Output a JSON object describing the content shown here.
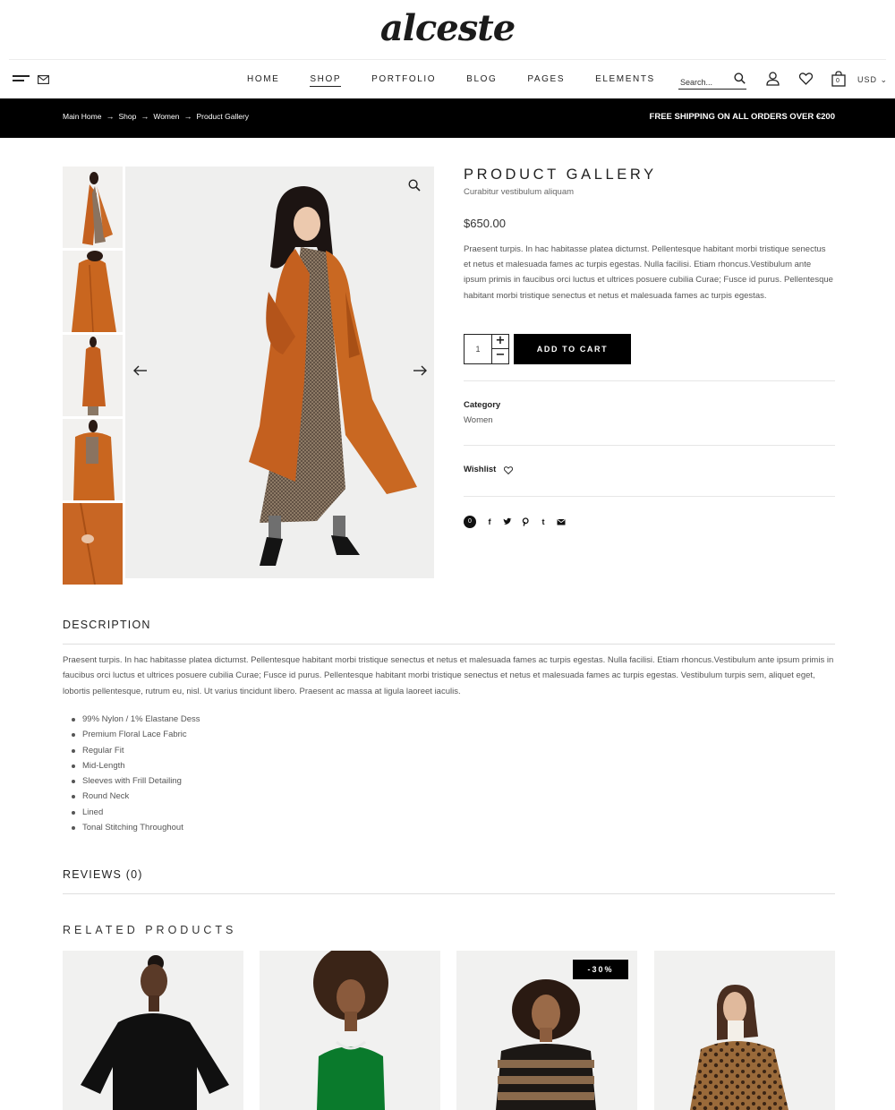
{
  "brand": {
    "logo": "alceste"
  },
  "nav": {
    "links": [
      "HOME",
      "SHOP",
      "PORTFOLIO",
      "BLOG",
      "PAGES",
      "ELEMENTS"
    ],
    "active": "SHOP",
    "search_placeholder": "Search...",
    "cart_count": "0",
    "currency": "USD"
  },
  "breadcrumb": [
    "Main Home",
    "Shop",
    "Women",
    "Product Gallery"
  ],
  "shipping_notice": "FREE SHIPPING ON ALL ORDERS OVER €200",
  "product": {
    "title": "PRODUCT GALLERY",
    "subtitle": "Curabitur vestibulum aliquam",
    "price": "$650.00",
    "description": "Praesent turpis. In hac habitasse platea dictumst. Pellentesque habitant morbi tristique senectus et netus et malesuada fames ac turpis egestas. Nulla facilisi. Etiam rhoncus.Vestibulum ante ipsum primis in faucibus orci luctus et ultrices posuere cubilia Curae; Fusce id purus. Pellentesque habitant morbi tristique senectus et netus et malesuada fames ac turpis egestas.",
    "quantity": "1",
    "add_to_cart": "ADD TO CART",
    "category_label": "Category",
    "category_value": "Women",
    "wishlist_label": "Wishlist",
    "share_count": "0",
    "share_icons": [
      "facebook-icon",
      "twitter-icon",
      "pinterest-icon",
      "tumblr-icon",
      "email-icon"
    ]
  },
  "description_section": {
    "title": "DESCRIPTION",
    "body": "Praesent turpis. In hac habitasse platea dictumst. Pellentesque habitant morbi tristique senectus et netus et malesuada fames ac turpis egestas. Nulla facilisi. Etiam rhoncus.Vestibulum ante ipsum primis in faucibus orci luctus et ultrices posuere cubilia Curae; Fusce id purus. Pellentesque habitant morbi tristique senectus et netus et malesuada fames ac turpis egestas. Vestibulum turpis sem, aliquet eget, lobortis pellentesque, rutrum eu, nisl. Ut varius tincidunt libero. Praesent ac massa at ligula laoreet iaculis.",
    "features": [
      "99% Nylon / 1% Elastane Dess",
      "Premium Floral Lace Fabric",
      "Regular Fit",
      "Mid-Length",
      "Sleeves with Frill Detailing",
      "Round Neck",
      "Lined",
      "Tonal Stitching Throughout"
    ]
  },
  "reviews_title": "REVIEWS (0)",
  "related": {
    "title": "RELATED PRODUCTS",
    "sale_badge": "-30%"
  },
  "colors": {
    "accent": "#000000",
    "coat": "#c4601f",
    "page_bg": "#ffffff",
    "image_bg": "#efefee"
  }
}
